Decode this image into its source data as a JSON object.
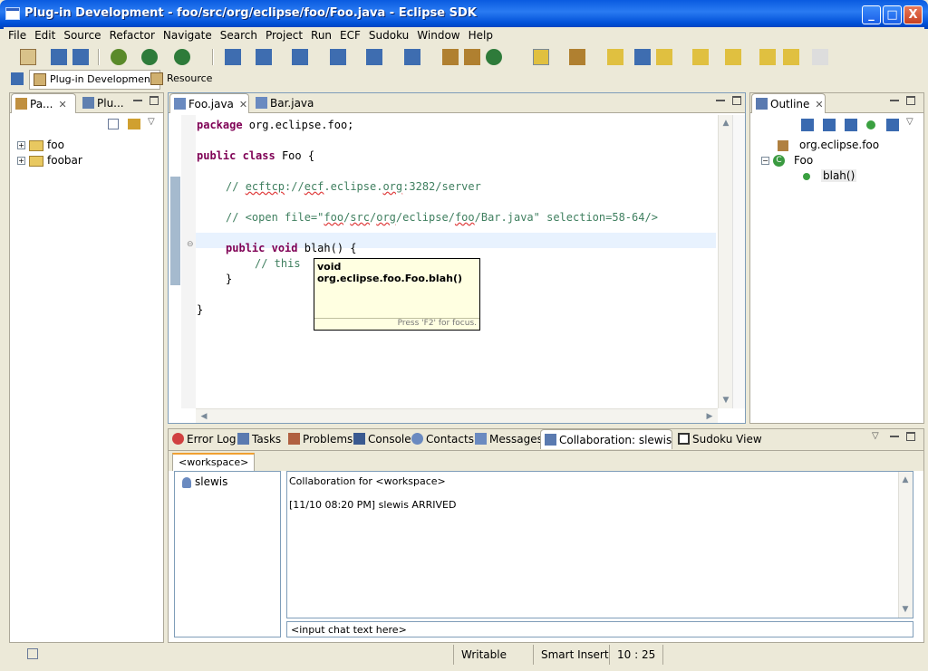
{
  "window": {
    "title": "Plug-in Development - foo/src/org/eclipse/foo/Foo.java - Eclipse SDK",
    "minimize": "_",
    "maximize": "□",
    "close": "X"
  },
  "menu": [
    "File",
    "Edit",
    "Source",
    "Refactor",
    "Navigate",
    "Search",
    "Project",
    "Run",
    "ECF",
    "Sudoku",
    "Window",
    "Help"
  ],
  "perspectives": [
    "Plug-in Development",
    "Resource"
  ],
  "package_explorer": {
    "tabs": [
      "Pa...",
      "Plu..."
    ],
    "items": [
      "foo",
      "foobar"
    ]
  },
  "editor": {
    "tabs": [
      "Foo.java",
      "Bar.java"
    ],
    "code": {
      "l1_kw": "package",
      "l1_rest": " org.eclipse.foo;",
      "l2_kw1": "public",
      "l2_kw2": "class",
      "l2_rest": " Foo {",
      "l3_pre": "// ",
      "l3_u1": "ecftcp",
      "l3_mid1": "://",
      "l3_u2": "ecf",
      "l3_mid2": ".eclipse.",
      "l3_u3": "org",
      "l3_rest": ":3282/server",
      "l4_pre": "// <open file=\"",
      "l4_u1": "foo",
      "l4_mid1": "/",
      "l4_u2": "src",
      "l4_mid2": "/",
      "l4_u3": "org",
      "l4_mid3": "/eclipse/",
      "l4_u4": "foo",
      "l4_rest": "/Bar.java\" selection=58-64/>",
      "l5_kw1": "public",
      "l5_kw2": "void",
      "l5_rest": " blah() {",
      "l6": "// this",
      "l7": "}",
      "l8": "}"
    },
    "hover": {
      "signature": "void org.eclipse.foo.Foo.blah()",
      "hint": "Press 'F2' for focus."
    }
  },
  "outline": {
    "tab": "Outline",
    "items": [
      "org.eclipse.foo",
      "Foo",
      "blah()"
    ]
  },
  "bottom": {
    "tabs": [
      "Error Log",
      "Tasks",
      "Problems",
      "Console",
      "Contacts",
      "Messages",
      "Collaboration: slewis",
      "Sudoku View"
    ],
    "subtab": "<workspace>",
    "users": [
      "slewis"
    ],
    "chat_lines": [
      "Collaboration for <workspace>",
      "[11/10 08:20 PM] slewis ARRIVED"
    ],
    "chat_input": "<input chat text here>"
  },
  "status": {
    "writable": "Writable",
    "insert_mode": "Smart Insert",
    "position": "10 : 25"
  },
  "colors": {
    "keyword": "#7f0055",
    "comment": "#3f7f5f",
    "titlebar": "#0a5be0"
  }
}
